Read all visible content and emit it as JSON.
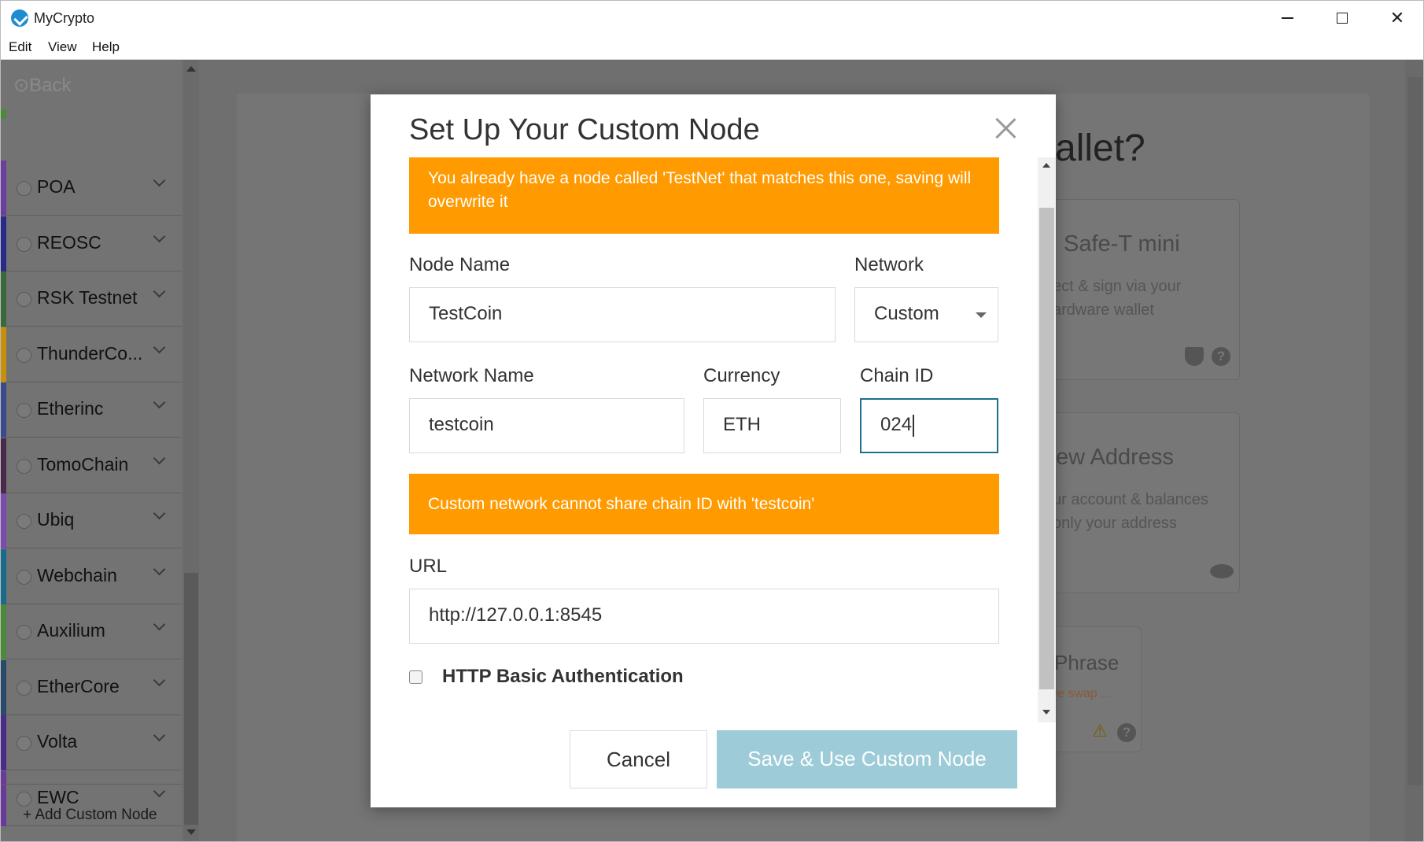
{
  "window": {
    "title": "MyCrypto"
  },
  "menu": [
    "Edit",
    "View",
    "Help"
  ],
  "sidebar": {
    "back_label": "Back",
    "networks": [
      {
        "label": "POA",
        "color": "#6a3fa0"
      },
      {
        "label": "REOSC",
        "color": "#2a2a8a"
      },
      {
        "label": "RSK Testnet",
        "color": "#3a6a3a"
      },
      {
        "label": "ThunderCo...",
        "color": "#c8900a"
      },
      {
        "label": "Etherinc",
        "color": "#3a4a8a"
      },
      {
        "label": "TomoChain",
        "color": "#4a2a4a"
      },
      {
        "label": "Ubiq",
        "color": "#7a4ab0"
      },
      {
        "label": "Webchain",
        "color": "#1a6a8a"
      },
      {
        "label": "Auxilium",
        "color": "#4a8a3a"
      },
      {
        "label": "EtherCore",
        "color": "#2a4a6a"
      },
      {
        "label": "Volta",
        "color": "#4a2a8a"
      },
      {
        "label": "EWC",
        "color": "#6a3a9a"
      }
    ],
    "add_custom_node": "Add Custom Node"
  },
  "background": {
    "heading": "allet?",
    "cards": [
      {
        "title": "Safe-T mini",
        "text": [
          "ect & sign via your",
          "ardware wallet"
        ]
      },
      {
        "title": "ew Address",
        "text": [
          "ur account & balances",
          "only your address"
        ]
      },
      {
        "title": "Phrase",
        "text": [
          "ve swap ..."
        ]
      }
    ]
  },
  "modal": {
    "title": "Set Up Your Custom Node",
    "warning_top": "You already have a node called 'TestNet' that matches this one, saving will overwrite it",
    "node_name": {
      "label": "Node Name",
      "value": "TestCoin"
    },
    "network": {
      "label": "Network",
      "value": "Custom"
    },
    "network_name": {
      "label": "Network Name",
      "value": "testcoin"
    },
    "currency": {
      "label": "Currency",
      "value": "ETH"
    },
    "chain_id": {
      "label": "Chain ID",
      "value": "024"
    },
    "warning_chain": "Custom network cannot share chain ID with 'testcoin'",
    "url": {
      "label": "URL",
      "value": "http://127.0.0.1:8545"
    },
    "http_auth": {
      "label": "HTTP Basic Authentication",
      "checked": false
    },
    "cancel_label": "Cancel",
    "save_label": "Save & Use Custom Node"
  }
}
